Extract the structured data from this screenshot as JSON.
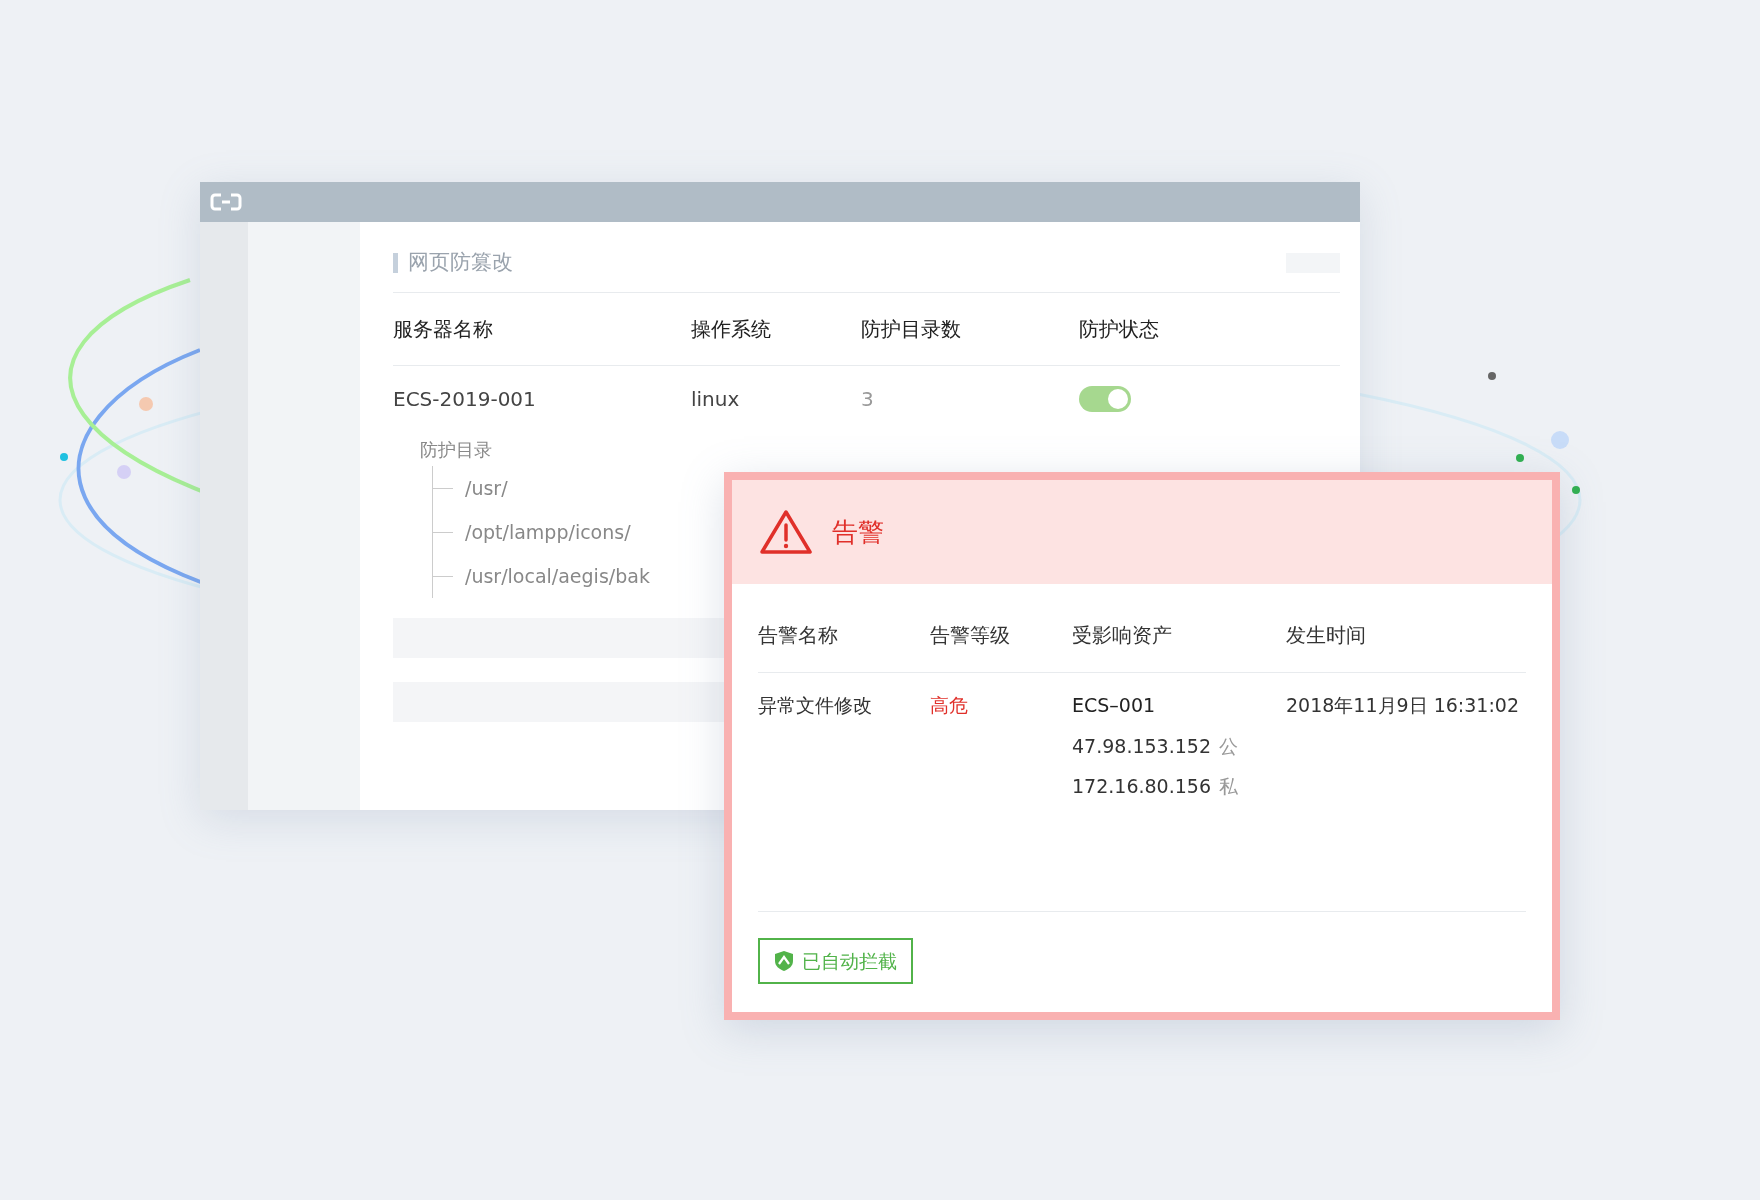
{
  "panel": {
    "title": "网页防篡改",
    "columns": [
      "服务器名称",
      "操作系统",
      "防护目录数",
      "防护状态"
    ],
    "rows": [
      {
        "server": "ECS-2019-001",
        "os": "linux",
        "dir_count": "3",
        "protected": true,
        "dirs_label": "防护目录",
        "dirs": [
          "/usr/",
          "/opt/lampp/icons/",
          "/usr/local/aegis/bak"
        ]
      }
    ]
  },
  "alert": {
    "title": "告警",
    "columns": [
      "告警名称",
      "告警等级",
      "受影响资产",
      "发生时间"
    ],
    "rows": [
      {
        "name": "异常文件修改",
        "level": "高危",
        "asset": "ECS–001",
        "ips": [
          {
            "address": "47.98.153.152",
            "tag": "公"
          },
          {
            "address": "172.16.80.156",
            "tag": "私"
          }
        ],
        "time": "2018年11月9日 16:31:02"
      }
    ],
    "action": "已自动拦截"
  }
}
